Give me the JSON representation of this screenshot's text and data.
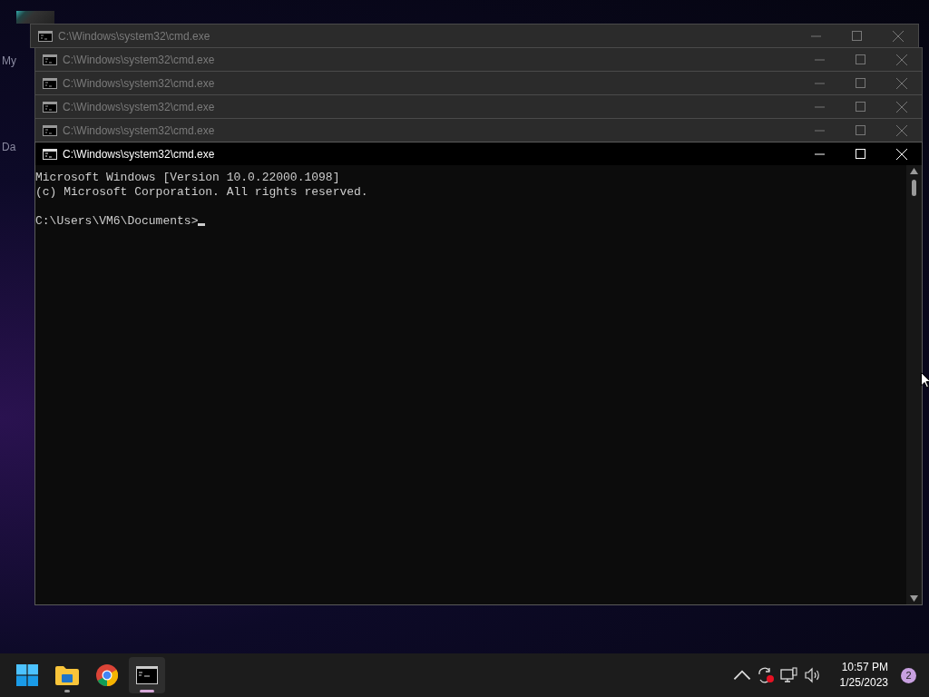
{
  "desktop": {
    "labels": [
      "My",
      "Da"
    ]
  },
  "windows": [
    {
      "title": "C:\\Windows\\system32\\cmd.exe",
      "active": false
    },
    {
      "title": "C:\\Windows\\system32\\cmd.exe",
      "active": false
    },
    {
      "title": "C:\\Windows\\system32\\cmd.exe",
      "active": false
    },
    {
      "title": "C:\\Windows\\system32\\cmd.exe",
      "active": false
    },
    {
      "title": "C:\\Windows\\system32\\cmd.exe",
      "active": false
    },
    {
      "title": "C:\\Windows\\system32\\cmd.exe",
      "active": true
    }
  ],
  "console": {
    "lines": [
      {
        "kind": "output",
        "text": "Microsoft Windows [Version 10.0.22000.1098]"
      },
      {
        "kind": "output",
        "text": "(c) Microsoft Corporation. All rights reserved."
      },
      {
        "kind": "prompt",
        "text": "C:\\Users\\VM6\\Documents>"
      }
    ]
  },
  "taskbar": {
    "apps": [
      {
        "kind": "start",
        "running": false,
        "selected": false
      },
      {
        "kind": "folder",
        "running": true,
        "selected": false
      },
      {
        "kind": "browser",
        "running": false,
        "selected": false
      },
      {
        "kind": "terminal",
        "running": true,
        "selected": true
      }
    ],
    "time": "10:57 PM",
    "date": "1/25/2023",
    "notifications": "2"
  }
}
